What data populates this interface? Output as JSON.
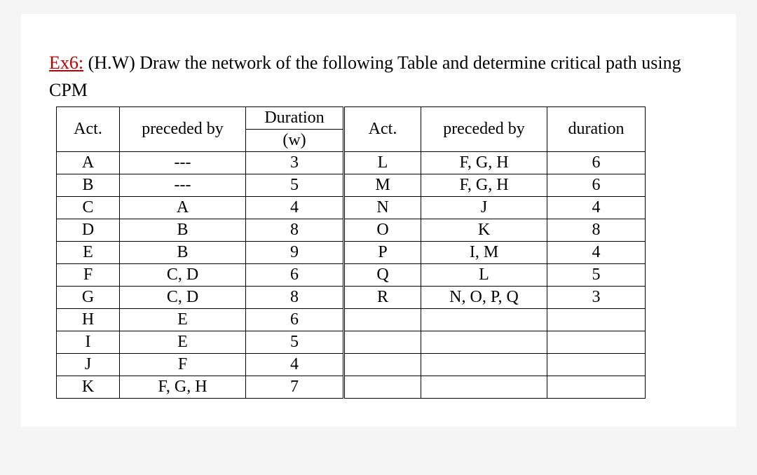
{
  "heading": {
    "ex_label": "Ex6:",
    "rest": " (H.W) Draw the network of the following Table and determine critical path using CPM"
  },
  "headers": {
    "left_act": "Act.",
    "left_pred": "preceded by",
    "left_dur_line1": "Duration",
    "left_dur_line2": "(w)",
    "right_act": "Act.",
    "right_pred": "preceded by",
    "right_dur": "duration"
  },
  "rows": [
    {
      "la": "A",
      "lp": "---",
      "ld": "3",
      "ra": "L",
      "rp": "F, G, H",
      "rd": "6"
    },
    {
      "la": "B",
      "lp": "---",
      "ld": "5",
      "ra": "M",
      "rp": "F, G, H",
      "rd": "6"
    },
    {
      "la": "C",
      "lp": "A",
      "ld": "4",
      "ra": "N",
      "rp": "J",
      "rd": "4"
    },
    {
      "la": "D",
      "lp": "B",
      "ld": "8",
      "ra": "O",
      "rp": "K",
      "rd": "8"
    },
    {
      "la": "E",
      "lp": "B",
      "ld": "9",
      "ra": "P",
      "rp": "I, M",
      "rd": "4"
    },
    {
      "la": "F",
      "lp": "C, D",
      "ld": "6",
      "ra": "Q",
      "rp": "L",
      "rd": "5"
    },
    {
      "la": "G",
      "lp": "C, D",
      "ld": "8",
      "ra": "R",
      "rp": "N, O, P, Q",
      "rd": "3"
    },
    {
      "la": "H",
      "lp": "E",
      "ld": "6",
      "ra": "",
      "rp": "",
      "rd": ""
    },
    {
      "la": "I",
      "lp": "E",
      "ld": "5",
      "ra": "",
      "rp": "",
      "rd": ""
    },
    {
      "la": "J",
      "lp": "F",
      "ld": "4",
      "ra": "",
      "rp": "",
      "rd": ""
    },
    {
      "la": "K",
      "lp": "F, G, H",
      "ld": "7",
      "ra": "",
      "rp": "",
      "rd": ""
    }
  ]
}
